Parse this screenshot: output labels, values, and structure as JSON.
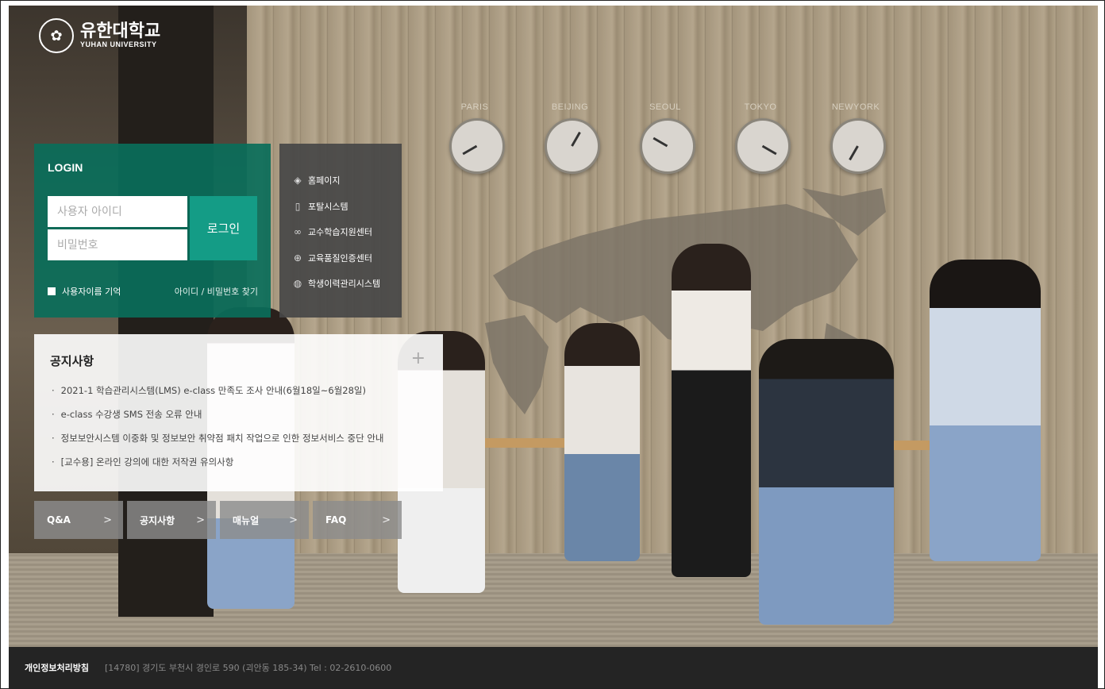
{
  "logo": {
    "name_ko": "유한대학교",
    "name_en": "YUHAN UNIVERSITY"
  },
  "clocks": [
    "PARIS",
    "BEIJING",
    "SEOUL",
    "TOKYO",
    "NEWYORK"
  ],
  "login": {
    "title": "LOGIN",
    "id_placeholder": "사용자 아이디",
    "pw_placeholder": "비밀번호",
    "button": "로그인",
    "remember": "사용자이름 기억",
    "find": "아이디 / 비밀번호 찾기"
  },
  "links": [
    {
      "label": "홈페이지",
      "icon": "layers-icon"
    },
    {
      "label": "포탈시스템",
      "icon": "document-icon"
    },
    {
      "label": "교수학습지원센터",
      "icon": "link-icon"
    },
    {
      "label": "교육품질인증센터",
      "icon": "crosshair-icon"
    },
    {
      "label": "학생이력관리시스템",
      "icon": "globe-icon"
    }
  ],
  "notice": {
    "title": "공지사항",
    "more": "+",
    "items": [
      "2021-1 학습관리시스템(LMS) e-class 만족도 조사 안내(6월18일~6월28일)",
      "e-class 수강생 SMS 전송 오류 안내",
      "정보보안시스템 이중화 및 정보보안 취약점 패치 작업으로 인한 정보서비스 중단 안내",
      "[교수용] 온라인 강의에 대한 저작권 유의사항"
    ]
  },
  "tabs": [
    "Q&A",
    "공지사항",
    "매뉴얼",
    "FAQ"
  ],
  "footer": {
    "policy": "개인정보처리방침",
    "address": "[14780] 경기도 부천시 경인로 590 (괴안동 185-34)   Tel : 02-2610-0600"
  },
  "colors": {
    "login_bg": "#0a6e5a",
    "login_button": "#149c86",
    "links_bg": "#464646",
    "footer_bg": "#242424"
  }
}
